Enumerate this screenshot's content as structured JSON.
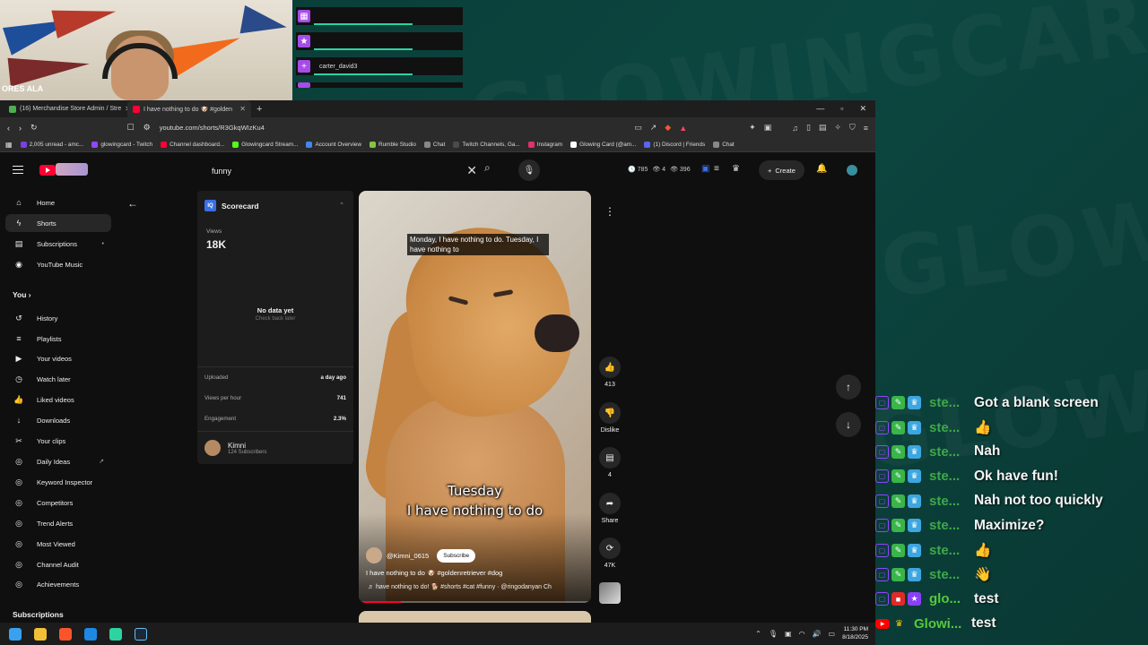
{
  "background": {
    "words": [
      "GLOWINGCARD",
      "GLOWING"
    ]
  },
  "webcam": {
    "sign_text": "ORES  ALA"
  },
  "alerts": [
    {
      "icon": "grid-icon",
      "name": ""
    },
    {
      "icon": "star-icon",
      "name": ""
    },
    {
      "icon": "plus-icon",
      "name": "carter_david3"
    },
    {
      "icon": "triangle-icon",
      "name": ""
    }
  ],
  "browser": {
    "tabs": [
      {
        "label": "(16) Merchandise Store Admin / Stre",
        "icon_color": "#4caf50",
        "active": false
      },
      {
        "label": "I have nothing to do 🐶 #golden",
        "icon_color": "#ff0033",
        "active": true
      }
    ],
    "url": "youtube.com/shorts/R3GkqWIzKu4",
    "bookmarks": [
      {
        "label": "2,005 unread - amc...",
        "color": "#7b3fe4"
      },
      {
        "label": "glowingcard - Twitch",
        "color": "#9146ff"
      },
      {
        "label": "Channel dashboard...",
        "color": "#ff0033"
      },
      {
        "label": "Glowingcard Stream...",
        "color": "#53fc18"
      },
      {
        "label": "Account Overview",
        "color": "#4285f4"
      },
      {
        "label": "Rumble Studio",
        "color": "#85c742"
      },
      {
        "label": "Chat",
        "color": "#888888"
      },
      {
        "label": "Twitch Channels, Ga...",
        "color": "#4a4a4a"
      },
      {
        "label": "Instagram",
        "color": "#e1306c"
      },
      {
        "label": "Glowing Card (@am...",
        "color": "#ffffff"
      },
      {
        "label": "(1) Discord | Friends",
        "color": "#5865f2"
      },
      {
        "label": "Chat",
        "color": "#888888"
      }
    ]
  },
  "youtube": {
    "search_value": "funny",
    "stats": [
      "🕓 785",
      "👁 4",
      "👁 396"
    ],
    "create_label": "Create",
    "nav": [
      {
        "icon": "home-icon",
        "glyph": "⌂",
        "label": "Home",
        "active": false
      },
      {
        "icon": "shorts-icon",
        "glyph": "ϟ",
        "label": "Shorts",
        "active": true
      },
      {
        "icon": "subscriptions-icon",
        "glyph": "▤",
        "label": "Subscriptions",
        "active": false,
        "ext": "•"
      },
      {
        "icon": "youtube-music-icon",
        "glyph": "◉",
        "label": "YouTube Music",
        "active": false
      }
    ],
    "you_label": "You  ›",
    "you_nav": [
      {
        "icon": "history-icon",
        "glyph": "↺",
        "label": "History"
      },
      {
        "icon": "playlists-icon",
        "glyph": "≡",
        "label": "Playlists"
      },
      {
        "icon": "your-videos-icon",
        "glyph": "▶",
        "label": "Your videos"
      },
      {
        "icon": "watch-later-icon",
        "glyph": "◷",
        "label": "Watch later"
      },
      {
        "icon": "liked-videos-icon",
        "glyph": "👍",
        "label": "Liked videos"
      },
      {
        "icon": "downloads-icon",
        "glyph": "↓",
        "label": "Downloads"
      },
      {
        "icon": "your-clips-icon",
        "glyph": "✂",
        "label": "Your clips"
      },
      {
        "icon": "daily-ideas-icon",
        "glyph": "◎",
        "label": "Daily Ideas",
        "ext": "↗"
      },
      {
        "icon": "keyword-inspector-icon",
        "glyph": "◎",
        "label": "Keyword Inspector"
      },
      {
        "icon": "competitors-icon",
        "glyph": "◎",
        "label": "Competitors"
      },
      {
        "icon": "trend-alerts-icon",
        "glyph": "◎",
        "label": "Trend Alerts"
      },
      {
        "icon": "most-viewed-icon",
        "glyph": "◎",
        "label": "Most Viewed"
      },
      {
        "icon": "channel-audit-icon",
        "glyph": "◎",
        "label": "Channel Audit"
      },
      {
        "icon": "achievements-icon",
        "glyph": "◎",
        "label": "Achievements"
      }
    ],
    "subscriptions_label": "Subscriptions",
    "scorecard": {
      "title": "Scorecard",
      "logo_text": "IQ",
      "views_label": "Views",
      "views_value": "18K",
      "no_data": "No data yet",
      "check_back": "Check back later",
      "uploaded_label": "Uploaded",
      "uploaded_value": "a day ago",
      "vph_label": "Views per hour",
      "vph_value": "741",
      "engagement_label": "Engagement",
      "engagement_value": "2.3%",
      "channel_name": "Kimni",
      "channel_subs": "124 Subscribers"
    },
    "short": {
      "caption_top": "Monday, I have nothing to do. Tuesday, I have nothing to",
      "caption_line1": "Tuesday",
      "caption_line2": "I have nothing to do",
      "channel": "@Kimni_0615",
      "subscribe_label": "Subscribe",
      "title": "I have nothing to do 🐶 #goldenretriever #dog",
      "music": "♬  have nothing to do! 🐕 #shorts #cat #funny · @ringodanyan    Ch",
      "progress": 0.18
    },
    "actions": {
      "like_count": "413",
      "dislike_label": "Dislike",
      "comment_count": "4",
      "share_label": "Share",
      "remix_count": "47K"
    }
  },
  "taskbar": {
    "apps": [
      {
        "name": "windows-start-icon",
        "color": "#3aa0f0"
      },
      {
        "name": "file-explorer-icon",
        "color": "#f2c037"
      },
      {
        "name": "brave-browser-icon",
        "color": "#fb542b"
      },
      {
        "name": "vscode-icon",
        "color": "#1e88e5"
      },
      {
        "name": "app-green-icon",
        "color": "#2dd3a0"
      },
      {
        "name": "steam-icon",
        "color": "#1b2838"
      }
    ],
    "time": "11:30 PM",
    "date": "8/18/2025"
  },
  "chat": [
    {
      "badges": [
        "twitch",
        "green",
        "blue"
      ],
      "user": "ste...",
      "msg": "Got a blank screen"
    },
    {
      "badges": [
        "twitch",
        "green",
        "blue"
      ],
      "user": "ste...",
      "msg": "👍"
    },
    {
      "badges": [
        "twitch",
        "green",
        "blue"
      ],
      "user": "ste...",
      "msg": "Nah"
    },
    {
      "badges": [
        "twitch",
        "green",
        "blue"
      ],
      "user": "ste...",
      "msg": "Ok have fun!"
    },
    {
      "badges": [
        "twitch",
        "green",
        "blue"
      ],
      "user": "ste...",
      "msg": "Nah not too quickly"
    },
    {
      "badges": [
        "twitch",
        "green",
        "blue"
      ],
      "user": "ste...",
      "msg": "Maximize?"
    },
    {
      "badges": [
        "twitch",
        "green",
        "blue"
      ],
      "user": "ste...",
      "msg": "👍"
    },
    {
      "badges": [
        "twitch",
        "green",
        "blue"
      ],
      "user": "ste...",
      "msg": "👋"
    },
    {
      "badges": [
        "twitch",
        "red",
        "purple"
      ],
      "user": "glo...",
      "msg": "test"
    },
    {
      "badges": [
        "yt",
        "crown"
      ],
      "user": "Glowi...",
      "msg": "test"
    }
  ]
}
